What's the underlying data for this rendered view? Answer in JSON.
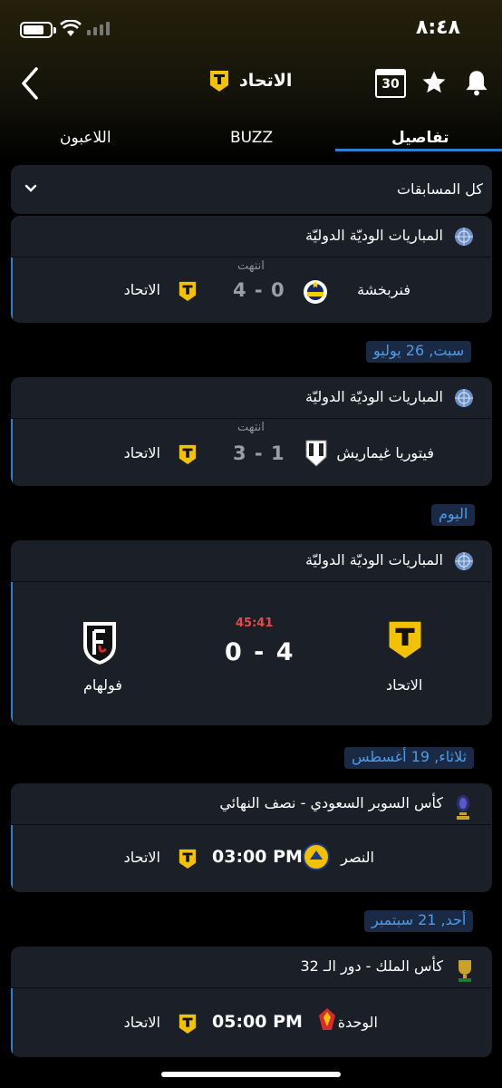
{
  "status_bar": {
    "time": "٨:٤٨"
  },
  "header": {
    "title": "الاتحاد",
    "calendar_day": "30"
  },
  "tabs": {
    "players": "اللاعبون",
    "buzz": "BUZZ",
    "details": "تفاصيل"
  },
  "filter": {
    "label": "كل المسابقات"
  },
  "matches": [
    {
      "competition": "المباريات الوديّة الدوليّة",
      "status": "انتهت",
      "home": "فنربخشة",
      "score": "4 - 0",
      "away": "الاتحاد"
    },
    {
      "competition": "المباريات الوديّة الدوليّة",
      "status": "انتهت",
      "home": "فيتوريا غيماريش",
      "score": "3 - 1",
      "away": "الاتحاد"
    },
    {
      "competition": "المباريات الوديّة الدوليّة",
      "live_time": "45:41",
      "home": "الاتحاد",
      "score": "0 - 4",
      "away": "فولهام"
    },
    {
      "competition": "كأس السوبر السعودي - نصف النهائي",
      "home": "النصر",
      "time": "03:00 PM",
      "away": "الاتحاد"
    },
    {
      "competition": "كأس الملك  - دور الـ 32",
      "home": "الوحدة",
      "time": "05:00 PM",
      "away": "الاتحاد"
    }
  ],
  "dates": [
    "سبت, 26 يوليو",
    "اليوم",
    "ثلاثاء, 19 أغسطس",
    "أحد, 21 سبتمبر"
  ],
  "colors": {
    "accent": "#2f7fd1",
    "live": "#e24b4b",
    "card": "#1b1f27",
    "ittihad_yellow": "#f2c200"
  }
}
